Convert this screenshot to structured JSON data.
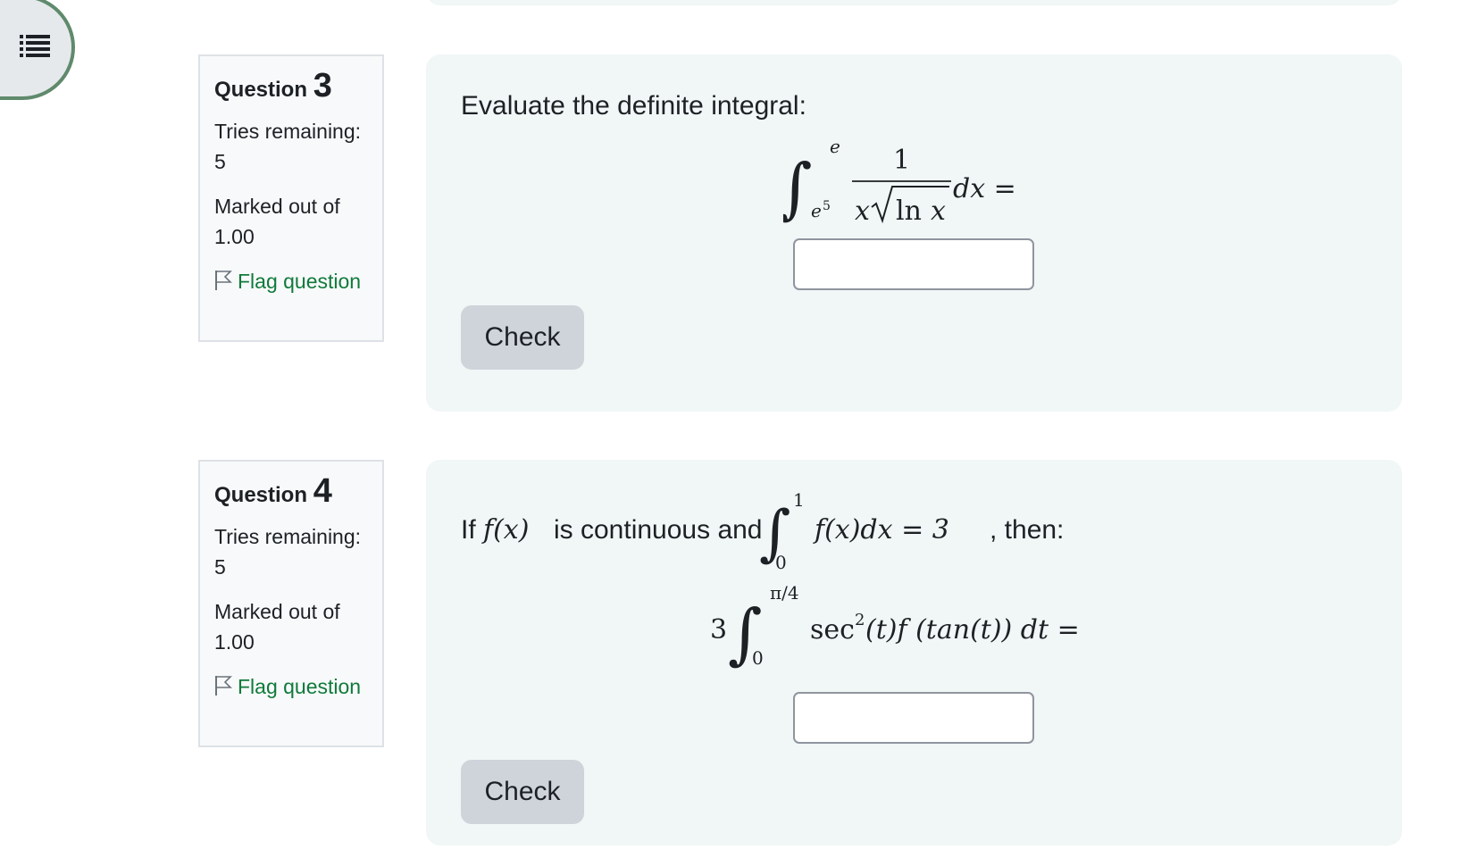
{
  "nav": {
    "icon": "list-icon"
  },
  "questions": [
    {
      "label": "Question",
      "number": "3",
      "tries": "Tries remaining: 5",
      "marked": "Marked out of 1.00",
      "flag": "Flag question",
      "prompt": "Evaluate the definite integral:",
      "math": {
        "upper": "e",
        "lower": "e",
        "lower_exp": "5",
        "numerator": "1",
        "den_x": "x",
        "den_ln": "ln",
        "den_x2": "x",
        "tail": "dx ="
      },
      "answer_value": "",
      "check_label": "Check"
    },
    {
      "label": "Question",
      "number": "4",
      "tries": "Tries remaining: 5",
      "marked": "Marked out of 1.00",
      "flag": "Flag question",
      "prompt_prefix": "If",
      "prompt_fx": "f(x)",
      "prompt_mid": "is continuous and",
      "prompt_int_upper": "1",
      "prompt_int_lower": "0",
      "prompt_int_body": "f(x)dx = 3",
      "prompt_suffix": ", then:",
      "math": {
        "coef": "3",
        "upper": "π/4",
        "lower": "0",
        "sec": "sec",
        "sec_exp": "2",
        "body": "(t)f (tan(t)) dt ="
      },
      "answer_value": "",
      "check_label": "Check"
    }
  ]
}
